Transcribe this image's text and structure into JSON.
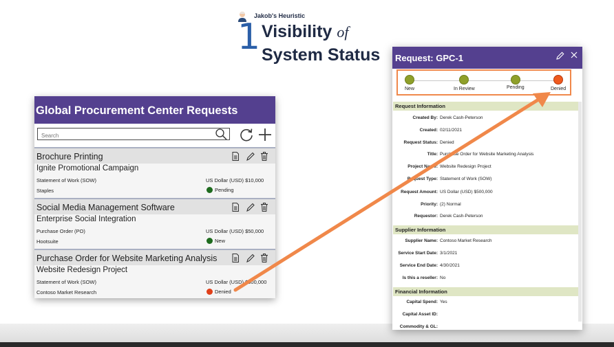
{
  "heuristic": {
    "label": "Jakob's Heuristic",
    "number": "1",
    "title_line1_word": "Visibility",
    "title_line1_of": "of",
    "title_line2": "System Status"
  },
  "app": {
    "title": "Global Procurement Center Requests",
    "search_placeholder": "Search",
    "items": [
      {
        "title": "Brochure Printing",
        "project": "Ignite Promotional Campaign",
        "type": "Statement of Work (SOW)",
        "amount": "US Dollar (USD) $10,000",
        "supplier": "Staples",
        "status": "Pending",
        "status_color": "#1e6b1e"
      },
      {
        "title": "Social Media Management Software",
        "project": "Enterprise Social Integration",
        "type": "Purchase Order (PO)",
        "amount": "US Dollar (USD) $50,000",
        "supplier": "Hootsuite",
        "status": "New",
        "status_color": "#1e6b1e"
      },
      {
        "title": "Purchase Order for Website Marketing Analysis",
        "project": "Website Redesign Project",
        "type": "Statement of Work (SOW)",
        "amount": "US Dollar (USD) $500,000",
        "supplier": "Contoso Market Research",
        "status": "Denied",
        "status_color": "#e0401a"
      }
    ]
  },
  "panel": {
    "title": "Request: GPC-1",
    "stages": [
      {
        "label": "New",
        "color": "#8fa02a"
      },
      {
        "label": "In Review",
        "color": "#8fa02a"
      },
      {
        "label": "Pending",
        "color": "#8fa02a"
      },
      {
        "label": "Denied",
        "color": "#ef5a1e"
      }
    ],
    "sections": {
      "request_information": "Request Information",
      "supplier_information": "Supplier Information",
      "financial_information": "Financial Information"
    },
    "request_fields": [
      {
        "label": "Created By:",
        "value": "Derek Cash-Peterson"
      },
      {
        "label": "Created:",
        "value": "02/11/2021"
      },
      {
        "label": "Request Status:",
        "value": "Denied"
      },
      {
        "label": "Title:",
        "value": "Purchase Order for Website Marketing Analysis"
      },
      {
        "label": "Project Name:",
        "value": "Website Redesign Project"
      },
      {
        "label": "Request Type:",
        "value": "Statement of Work (SOW)"
      },
      {
        "label": "Request Amount:",
        "value": "US Dollar (USD) $500,000"
      },
      {
        "label": "Priority:",
        "value": "(2) Normal"
      },
      {
        "label": "Requestor:",
        "value": "Derek Cash-Peterson"
      }
    ],
    "supplier_fields": [
      {
        "label": "Supplier Name:",
        "value": "Contoso Market Research"
      },
      {
        "label": "Service Start Date:",
        "value": "3/1/2021"
      },
      {
        "label": "Service End Date:",
        "value": "4/30/2021"
      },
      {
        "label": "Is this a reseller:",
        "value": "No"
      }
    ],
    "financial_fields": [
      {
        "label": "Capital Spend:",
        "value": "Yes"
      },
      {
        "label": "Capital Asset ID:",
        "value": ""
      },
      {
        "label": "Commodity & GL:",
        "value": ""
      }
    ]
  },
  "colors": {
    "header_purple": "#54408f",
    "arrow_orange": "#f0884a",
    "section_green": "#dfe6c4"
  }
}
